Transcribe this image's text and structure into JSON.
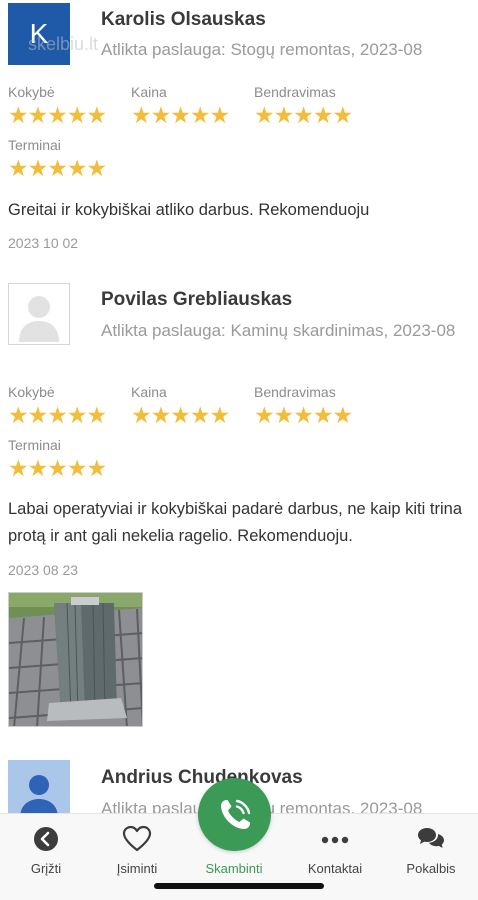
{
  "reviews": [
    {
      "avatar_letter": "K",
      "watermark": "skelbiu.lt",
      "name": "Karolis Olsauskas",
      "service": "Atlikta paslauga: Stogų remontas, 2023-08",
      "ratings": [
        {
          "label": "Kokybė",
          "stars": "★★★★★",
          "value": 5
        },
        {
          "label": "Kaina",
          "stars": "★★★★★",
          "value": 5
        },
        {
          "label": "Bendravimas",
          "stars": "★★★★★",
          "value": 5
        },
        {
          "label": "Terminai",
          "stars": "★★★★★",
          "value": 5
        }
      ],
      "comment": "Greitai ir kokybiškai atliko darbus. Rekomenduoju",
      "date": "2023 10 02"
    },
    {
      "name": "Povilas Grebliauskas",
      "service": "Atlikta paslauga: Kaminų skardinimas, 2023-08",
      "ratings": [
        {
          "label": "Kokybė",
          "stars": "★★★★★",
          "value": 5
        },
        {
          "label": "Kaina",
          "stars": "★★★★★",
          "value": 5
        },
        {
          "label": "Bendravimas",
          "stars": "★★★★★",
          "value": 5
        },
        {
          "label": "Terminai",
          "stars": "★★★★★",
          "value": 5
        }
      ],
      "comment": "Labai operatyviai ir kokybiškai padarė darbus, ne kaip kiti trina protą ir ant gali nekelia ragelio. Rekomenduoju.",
      "date": "2023 08 23",
      "photo_icon": "chimney-photo"
    },
    {
      "name": "Andrius Chudenkovas",
      "service": "Atlikta paslauga: Stogų remontas, 2023-08"
    }
  ],
  "tabbar": {
    "back": {
      "label": "Grįžti",
      "icon": "back-arrow-icon"
    },
    "save": {
      "label": "Įsiminti",
      "icon": "heart-icon"
    },
    "call": {
      "label": "Skambinti",
      "icon": "phone-icon"
    },
    "contacts": {
      "label": "Kontaktai",
      "icon": "more-dots-icon"
    },
    "chat": {
      "label": "Pokalbis",
      "icon": "chat-bubbles-icon"
    }
  },
  "colors": {
    "star": "#f2bd3a",
    "call_green": "#3a9a56",
    "avatar_blue": "#1e5aa8"
  }
}
